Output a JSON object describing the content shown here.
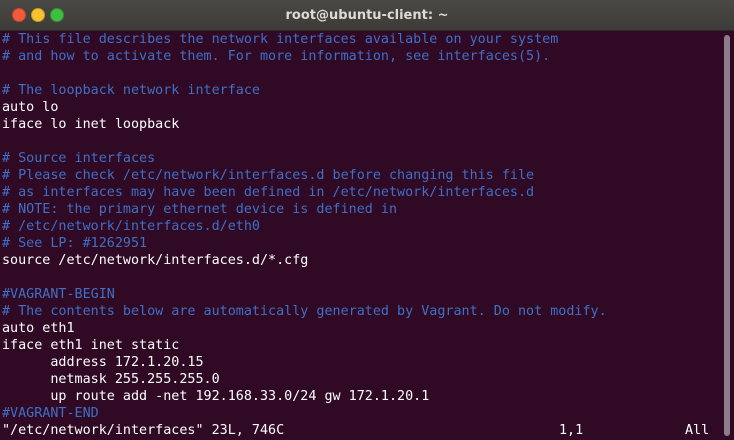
{
  "window": {
    "title": "root@ubuntu-client: ~",
    "buttons": {
      "close": "×",
      "minimize": "–",
      "maximize": "+"
    }
  },
  "terminal": {
    "lines": [
      {
        "text": "# This file describes the network interfaces available on your system",
        "comment": true
      },
      {
        "text": "# and how to activate them. For more information, see interfaces(5).",
        "comment": true
      },
      {
        "text": "",
        "comment": false
      },
      {
        "text": "# The loopback network interface",
        "comment": true
      },
      {
        "text": "auto lo",
        "comment": false
      },
      {
        "text": "iface lo inet loopback",
        "comment": false
      },
      {
        "text": "",
        "comment": false
      },
      {
        "text": "# Source interfaces",
        "comment": true
      },
      {
        "text": "# Please check /etc/network/interfaces.d before changing this file",
        "comment": true
      },
      {
        "text": "# as interfaces may have been defined in /etc/network/interfaces.d",
        "comment": true
      },
      {
        "text": "# NOTE: the primary ethernet device is defined in",
        "comment": true
      },
      {
        "text": "# /etc/network/interfaces.d/eth0",
        "comment": true
      },
      {
        "text": "# See LP: #1262951",
        "comment": true
      },
      {
        "text": "source /etc/network/interfaces.d/*.cfg",
        "comment": false
      },
      {
        "text": "",
        "comment": false
      },
      {
        "text": "#VAGRANT-BEGIN",
        "comment": true
      },
      {
        "text": "# The contents below are automatically generated by Vagrant. Do not modify.",
        "comment": true
      },
      {
        "text": "auto eth1",
        "comment": false
      },
      {
        "text": "iface eth1 inet static",
        "comment": false
      },
      {
        "text": "      address 172.1.20.15",
        "comment": false
      },
      {
        "text": "      netmask 255.255.255.0",
        "comment": false
      },
      {
        "text": "      up route add -net 192.168.33.0/24 gw 172.1.20.1",
        "comment": false
      },
      {
        "text": "#VAGRANT-END",
        "comment": true
      }
    ],
    "status": {
      "file_info": "\"/etc/network/interfaces\" 23L, 746C",
      "cursor_position": "1,1",
      "scroll_position": "All"
    }
  },
  "colors": {
    "background": "#300a24",
    "text": "#ffffff",
    "comment": "#3f6fc6",
    "titlebar": "#3c3b37"
  }
}
